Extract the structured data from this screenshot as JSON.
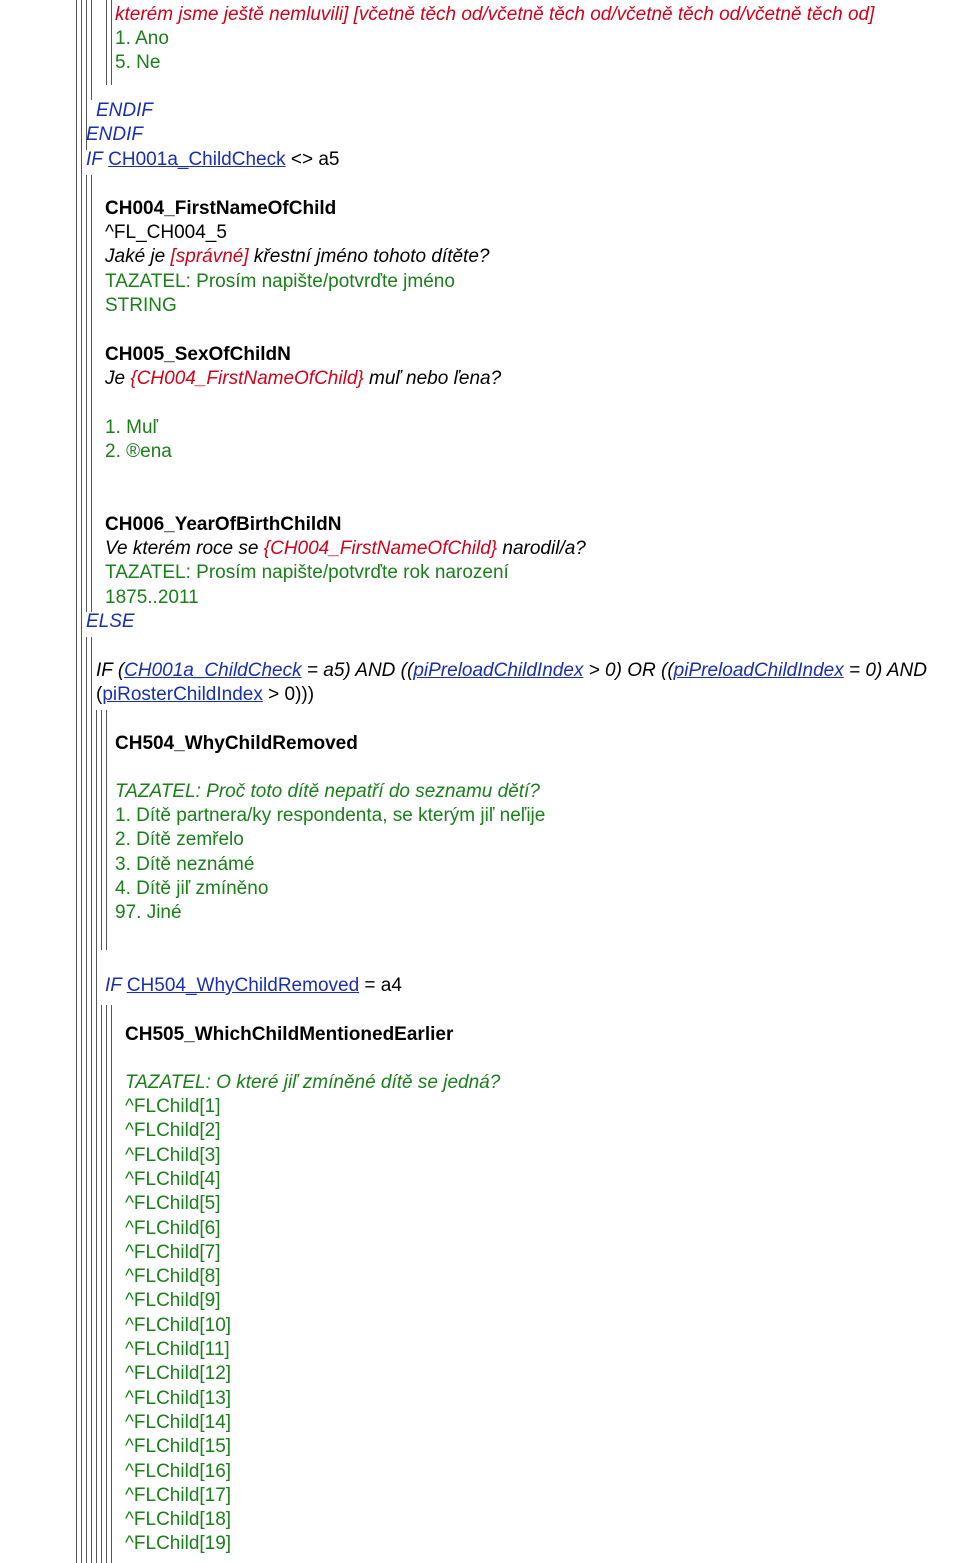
{
  "top": {
    "question_tail": "kterém jsme ještě nemluvili] [včetně těch od/včetně těch od/včetně těch od/včetně těch od]",
    "opt1": "1. Ano",
    "opt5": "5. Ne",
    "endif1": "ENDIF",
    "endif2": "ENDIF"
  },
  "if1": {
    "kw": "IF",
    "var": "CH001a_ChildCheck",
    "cond": "<> a5"
  },
  "ch004": {
    "name": "CH004_FirstNameOfChild",
    "fill": "^FL_CH004_5",
    "q_a": "Jaké je ",
    "q_b": "[správné]",
    "q_c": " křestní jméno tohoto dítěte?",
    "instr": "TAZATEL: Prosím napište/potvrďte jméno",
    "type": "STRING"
  },
  "ch005": {
    "name": "CH005_SexOfChildN",
    "q_a": "Je ",
    "q_b": "{CH004_FirstNameOfChild}",
    "q_c": " muľ nebo ľena?",
    "opt1": "1. Muľ",
    "opt2": "2. ®ena"
  },
  "ch006": {
    "name": "CH006_YearOfBirthChildN",
    "q_a": "Ve kterém roce se ",
    "q_b": "{CH004_FirstNameOfChild}",
    "q_c": " narodil/a?",
    "instr": "TAZATEL: Prosím napište/potvrďte rok narození",
    "range": "1875..2011"
  },
  "else": "ELSE",
  "if2": {
    "p1": "IF (",
    "v1": "CH001a_ChildCheck",
    "p2": " = a5) AND ((",
    "v2": "piPreloadChildIndex",
    "p3": " > 0) OR ((",
    "v3": "piPreloadChildIndex",
    "p4": " = 0) AND",
    "p5": "(",
    "v4": "piRosterChildIndex",
    "p6": " > 0)))"
  },
  "ch504": {
    "name": "CH504_WhyChildRemoved",
    "instr": "TAZATEL: Proč toto dítě nepatří do seznamu dětí?",
    "options": [
      "1. Dítě partnera/ky respondenta, se kterým jiľ neľije",
      "2. Dítě zemřelo",
      "3. Dítě neznámé",
      "4. Dítě jiľ zmíněno",
      "97. Jiné"
    ]
  },
  "if3": {
    "kw": "IF ",
    "var": "CH504_WhyChildRemoved",
    "cond": " = a4"
  },
  "ch505": {
    "name": "CH505_WhichChildMentionedEarlier",
    "instr": "TAZATEL: O které jiľ zmíněné dítě se jedná?",
    "options": [
      "^FLChild[1]",
      "^FLChild[2]",
      "^FLChild[3]",
      "^FLChild[4]",
      "^FLChild[5]",
      "^FLChild[6]",
      "^FLChild[7]",
      "^FLChild[8]",
      "^FLChild[9]",
      "^FLChild[10]",
      "^FLChild[11]",
      "^FLChild[12]",
      "^FLChild[13]",
      "^FLChild[14]",
      "^FLChild[15]",
      "^FLChild[16]",
      "^FLChild[17]",
      "^FLChild[18]",
      "^FLChild[19]"
    ]
  }
}
